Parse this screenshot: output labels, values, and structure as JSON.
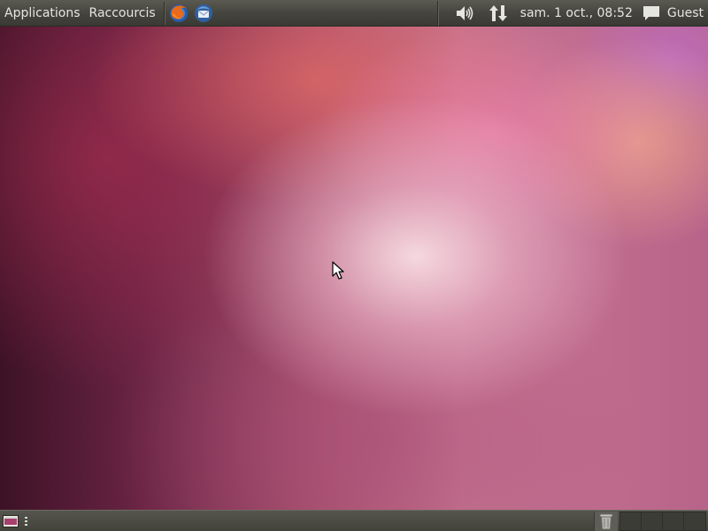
{
  "top_panel": {
    "menus": [
      "Applications",
      "Raccourcis"
    ],
    "launchers": [
      {
        "icon": "firefox-icon"
      },
      {
        "icon": "thunderbird-icon"
      }
    ],
    "indicators": {
      "volume_icon": "speaker-icon",
      "network_icon": "network-arrows-icon",
      "clock": "sam.  1 oct., 08:52",
      "messaging_icon": "speech-bubble-icon",
      "user": "Guest"
    }
  },
  "desktop": {
    "cursor_icon": "arrow-pointer-icon"
  },
  "bottom_panel": {
    "show_desktop_icon": "show-desktop-icon",
    "trash_icon": "trash-icon",
    "workspace_count": 4
  },
  "colors": {
    "panel": "#46463f",
    "panel_text": "#e6e6e0",
    "desktop_base": "#7a2e4c"
  }
}
